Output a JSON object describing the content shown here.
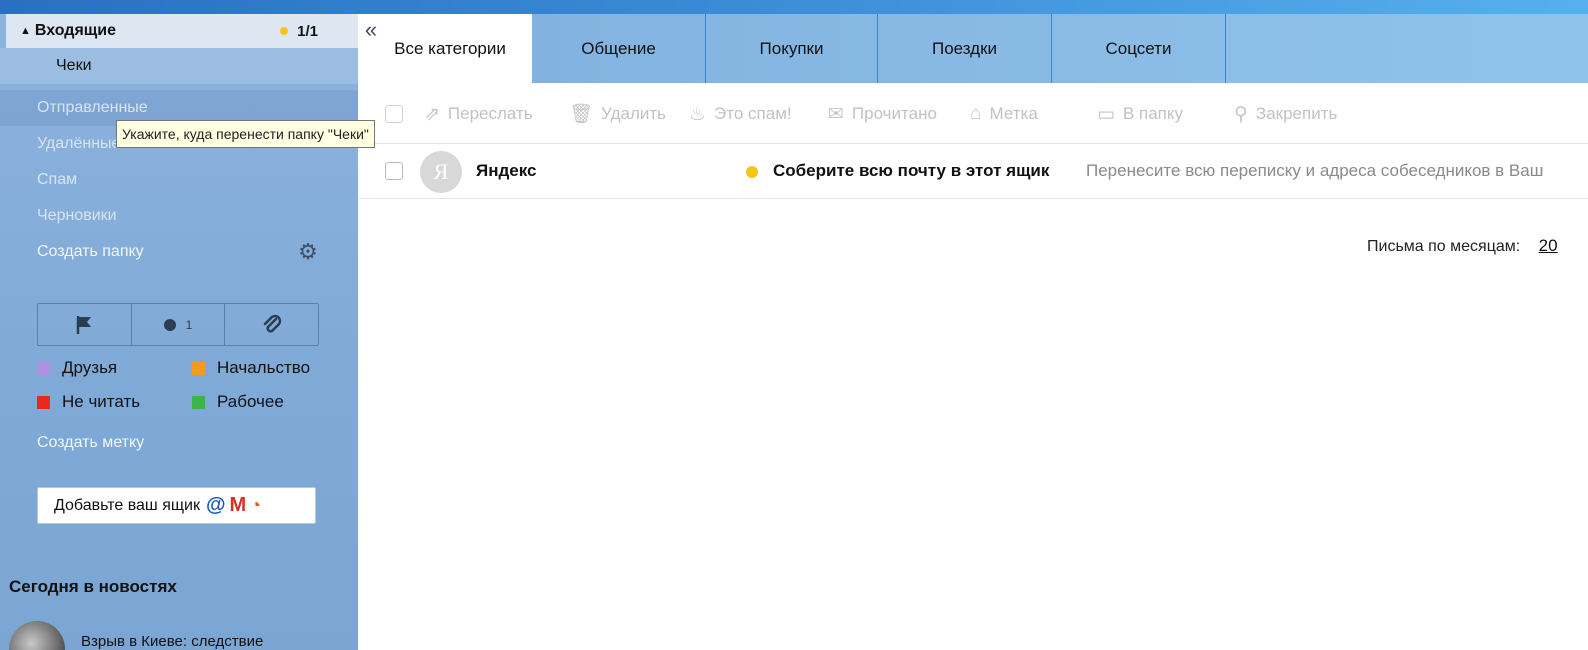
{
  "sidebar": {
    "inbox": {
      "label": "Входящие",
      "count": "1/1"
    },
    "folders": {
      "receipts": "Чеки",
      "sent": "Отправленные",
      "deleted": "Удалённые",
      "spam": "Спам",
      "drafts": "Черновики",
      "create_folder": "Создать папку"
    },
    "tooltip": "Укажите, куда перенести папку \"Чеки\"",
    "filters": {
      "unread_count": "1"
    },
    "labels": [
      {
        "name": "Друзья",
        "color": "#b18fe0"
      },
      {
        "name": "Начальство",
        "color": "#f39a1f"
      },
      {
        "name": "Не читать",
        "color": "#e8291c"
      },
      {
        "name": "Рабочее",
        "color": "#3ab54a"
      }
    ],
    "create_label": "Создать метку",
    "add_mailbox": "Добавьте ваш ящик",
    "news": {
      "title": "Сегодня в новостях",
      "item": "Взрыв в Киеве: следствие"
    }
  },
  "tabs": [
    "Все категории",
    "Общение",
    "Покупки",
    "Поездки",
    "Соцсети"
  ],
  "toolbar": {
    "forward": "Переслать",
    "delete": "Удалить",
    "spam": "Это спам!",
    "read": "Прочитано",
    "label": "Метка",
    "to_folder": "В папку",
    "pin": "Закрепить"
  },
  "messages": [
    {
      "avatar_letter": "Я",
      "sender": "Яндекс",
      "subject": "Соберите всю почту в этот ящик",
      "preview": "Перенесите всю переписку и адреса собеседников в Ваш"
    }
  ],
  "archive": {
    "label": "Письма по месяцам:",
    "year": "20"
  }
}
